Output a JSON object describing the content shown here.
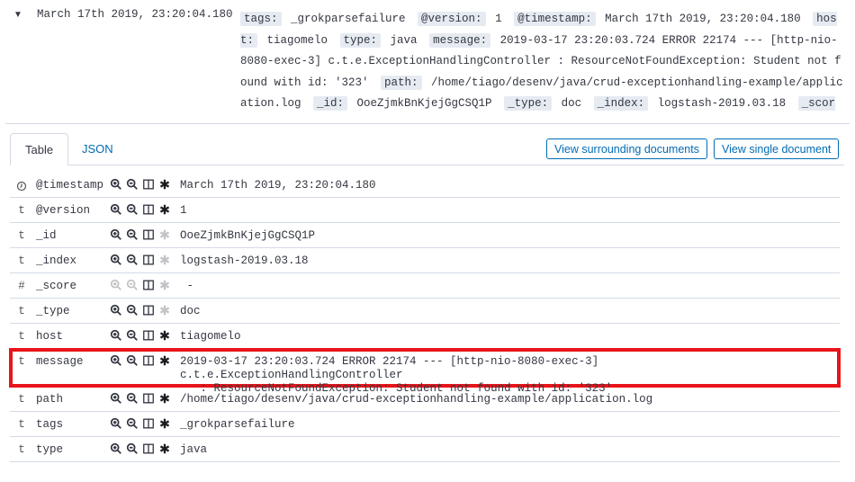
{
  "doc": {
    "timestamp": "March 17th 2019, 23:20:04.180",
    "summary": [
      {
        "k": "tags:",
        "v": "_grokparsefailure"
      },
      {
        "k": "@version:",
        "v": "1"
      },
      {
        "k": "@timestamp:",
        "v": "March 17th 2019, 23:20:04.180"
      },
      {
        "k": "host:",
        "v": "tiagomelo"
      },
      {
        "k": "type:",
        "v": "java"
      },
      {
        "k": "message:",
        "v": "2019-03-17 23:20:03.724 ERROR 22174 --- [http-nio-8080-exec-3] c.t.e.ExceptionHandlingController : ResourceNotFoundException: Student not found with id: '323'"
      },
      {
        "k": "path:",
        "v": "/home/tiago/desenv/java/crud-exceptionhandling-example/application.log"
      },
      {
        "k": "_id:",
        "v": "OoeZjmkBnKjejGgCSQ1P"
      },
      {
        "k": "_type:",
        "v": "doc"
      },
      {
        "k": "_index:",
        "v": "logstash-2019.03.18"
      },
      {
        "k": "_score:",
        "v": "-"
      }
    ]
  },
  "tabs": {
    "table": "Table",
    "json": "JSON"
  },
  "buttons": {
    "surrounding": "View surrounding documents",
    "single": "View single document"
  },
  "fields": [
    {
      "type": "clock",
      "name": "@timestamp",
      "value": "March 17th 2019, 23:20:04.180",
      "filter": true,
      "exists": true
    },
    {
      "type": "t",
      "name": "@version",
      "value": "1",
      "filter": true,
      "exists": true
    },
    {
      "type": "t",
      "name": "_id",
      "value": "OoeZjmkBnKjejGgCSQ1P",
      "filter": true,
      "exists": false
    },
    {
      "type": "t",
      "name": "_index",
      "value": "logstash-2019.03.18",
      "filter": true,
      "exists": false
    },
    {
      "type": "#",
      "name": "_score",
      "value": " -",
      "filter": false,
      "exists": false
    },
    {
      "type": "t",
      "name": "_type",
      "value": "doc",
      "filter": true,
      "exists": false
    },
    {
      "type": "t",
      "name": "host",
      "value": "tiagomelo",
      "filter": true,
      "exists": true
    },
    {
      "type": "t",
      "name": "message",
      "value": "2019-03-17 23:20:03.724 ERROR 22174 --- [http-nio-8080-exec-3] c.t.e.ExceptionHandlingController\n   : ResourceNotFoundException: Student not found with id: '323'",
      "filter": true,
      "exists": true,
      "highlighted": true
    },
    {
      "type": "t",
      "name": "path",
      "value": "/home/tiago/desenv/java/crud-exceptionhandling-example/application.log",
      "filter": true,
      "exists": true
    },
    {
      "type": "t",
      "name": "tags",
      "value": "_grokparsefailure",
      "filter": true,
      "exists": true
    },
    {
      "type": "t",
      "name": "type",
      "value": "java",
      "filter": true,
      "exists": true
    }
  ],
  "colors": {
    "accent": "#006bb4",
    "highlight": "#e8141a",
    "pill": "#e6ebf2"
  }
}
